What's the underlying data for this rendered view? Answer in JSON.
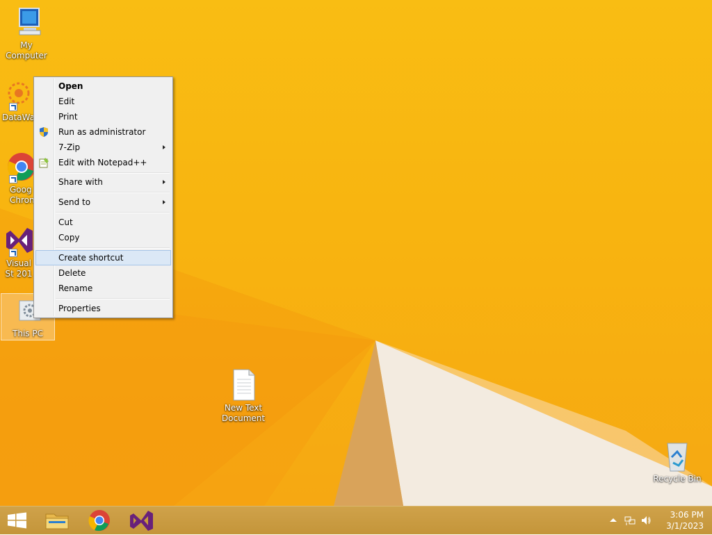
{
  "desktop": {
    "icons": [
      {
        "label": "My Computer",
        "icon": "computer-icon"
      },
      {
        "label": "DataWag",
        "icon": "datawag-icon"
      },
      {
        "label": "Goog Chron",
        "icon": "chrome-icon"
      },
      {
        "label": "Visual St 201",
        "icon": "visual-studio-icon"
      },
      {
        "label": "This PC",
        "icon": "this-pc-icon"
      },
      {
        "label": "New Text Document",
        "icon": "text-document-icon"
      },
      {
        "label": "Recycle Bin",
        "icon": "recycle-bin-icon"
      }
    ]
  },
  "context_menu": {
    "items": [
      {
        "label": "Open"
      },
      {
        "label": "Edit"
      },
      {
        "label": "Print"
      },
      {
        "label": "Run as administrator",
        "icon": "uac-shield-icon"
      },
      {
        "label": "7-Zip"
      },
      {
        "label": "Edit with Notepad++",
        "icon": "notepad-plus-plus-icon"
      },
      {
        "label": "Share with"
      },
      {
        "label": "Send to"
      },
      {
        "label": "Cut"
      },
      {
        "label": "Copy"
      },
      {
        "label": "Create shortcut"
      },
      {
        "label": "Delete"
      },
      {
        "label": "Rename"
      },
      {
        "label": "Properties"
      }
    ]
  },
  "taskbar": {
    "pinned": [
      "windows-start-icon",
      "file-explorer-icon",
      "chrome-icon",
      "visual-studio-icon"
    ],
    "tray": [
      "show-hidden-icons",
      "network-icon",
      "volume-icon"
    ],
    "clock": {
      "time": "3:06 PM",
      "date": "3/1/2023"
    }
  },
  "colors": {
    "desktop_top": "#f9bd13",
    "desktop_bottom": "#f6a812",
    "taskbar": "#c79a3c",
    "menu_bg": "#f0f0f0",
    "menu_highlight": "#dbe8f6"
  }
}
